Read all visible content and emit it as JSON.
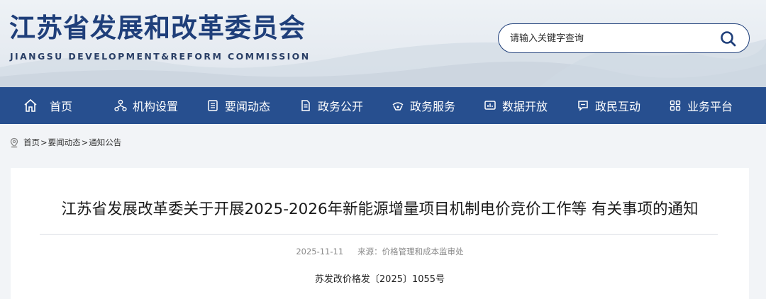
{
  "header": {
    "title": "江苏省发展和改革委员会",
    "subtitle": "JIANGSU DEVELOPMENT&REFORM COMMISSION",
    "search": {
      "placeholder": "请输入关键字查询"
    }
  },
  "nav": {
    "items": [
      {
        "label": "首页",
        "icon": "home-icon"
      },
      {
        "label": "机构设置",
        "icon": "org-chart-icon"
      },
      {
        "label": "要闻动态",
        "icon": "news-icon"
      },
      {
        "label": "政务公开",
        "icon": "document-icon"
      },
      {
        "label": "政务服务",
        "icon": "service-icon"
      },
      {
        "label": "数据开放",
        "icon": "data-icon"
      },
      {
        "label": "政民互动",
        "icon": "chat-icon"
      },
      {
        "label": "业务平台",
        "icon": "grid-icon"
      }
    ]
  },
  "breadcrumb": {
    "items": [
      "首页",
      "要闻动态",
      "通知公告"
    ],
    "separator": ">"
  },
  "article": {
    "title": "江苏省发展改革委关于开展2025-2026年新能源增量项目机制电价竞价工作等 有关事项的通知",
    "date": "2025-11-11",
    "source": "来源：价格管理和成本监审处",
    "doc_number": "苏发改价格发〔2025〕1055号"
  },
  "colors": {
    "brand_blue": "#274f8f",
    "title_blue": "#1f3f7a"
  }
}
